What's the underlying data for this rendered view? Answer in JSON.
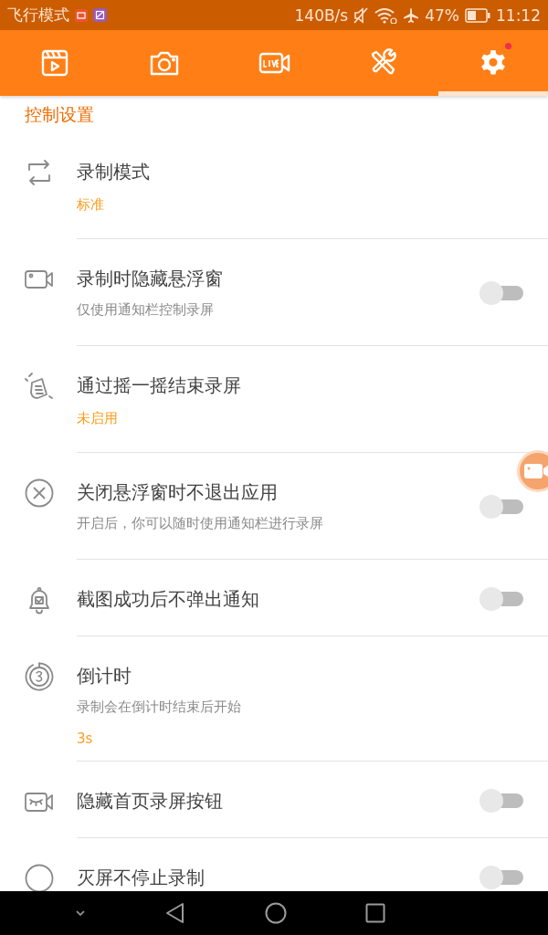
{
  "status_bar": {
    "mode": "飞行模式",
    "speed": "140B/s",
    "battery": "47%",
    "time": "11:12"
  },
  "tabs": [
    {
      "kind": "clapper",
      "selected": false,
      "badge": false
    },
    {
      "kind": "camera",
      "selected": false,
      "badge": false
    },
    {
      "kind": "live",
      "selected": false,
      "badge": false
    },
    {
      "kind": "tools",
      "selected": false,
      "badge": false
    },
    {
      "kind": "gear",
      "selected": true,
      "badge": true
    }
  ],
  "section_title": "控制设置",
  "rows": [
    {
      "kind": "value",
      "title": "录制模式",
      "value": "标准"
    },
    {
      "kind": "switch",
      "title": "录制时隐藏悬浮窗",
      "subtitle": "仅使用通知栏控制录屏",
      "on": false
    },
    {
      "kind": "value",
      "title": "通过摇一摇结束录屏",
      "value": "未启用"
    },
    {
      "kind": "switch",
      "title": "关闭悬浮窗时不退出应用",
      "subtitle": "开启后，你可以随时使用通知栏进行录屏",
      "on": false
    },
    {
      "kind": "switch",
      "title": "截图成功后不弹出通知",
      "on": false
    },
    {
      "kind": "value",
      "title": "倒计时",
      "subtitle": "录制会在倒计时结束后开始",
      "value": "3s"
    },
    {
      "kind": "switch",
      "title": "隐藏首页录屏按钮",
      "on": false
    },
    {
      "kind": "switch",
      "title": "灭屏不停止录制",
      "on": false
    }
  ]
}
